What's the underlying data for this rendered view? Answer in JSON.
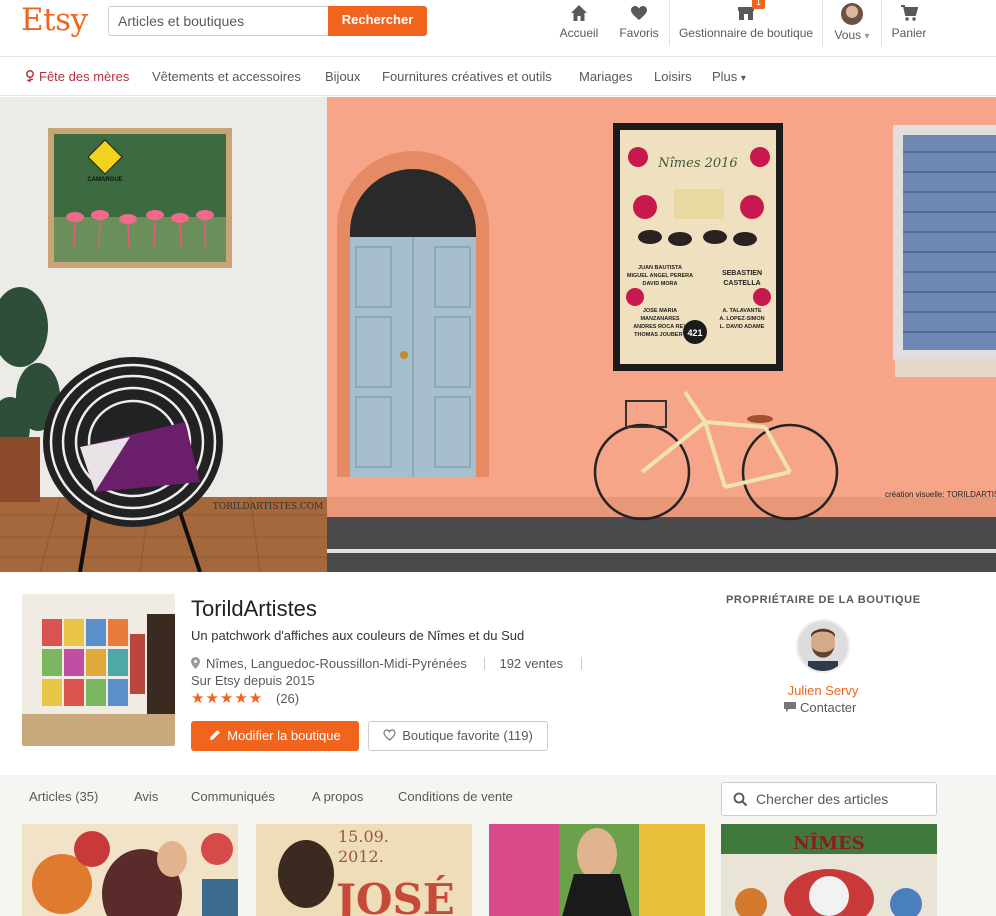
{
  "header": {
    "logo": "Etsy",
    "search_placeholder": "Articles et boutiques",
    "search_button": "Rechercher",
    "nav": {
      "home": "Accueil",
      "favorites": "Favoris",
      "shop_manager": "Gestionnaire de boutique",
      "shop_manager_badge": "1",
      "you": "Vous",
      "you_caret": "▾",
      "cart": "Panier"
    }
  },
  "categories": {
    "mothers_day": "Fête des mères",
    "clothing": "Vêtements et accessoires",
    "jewelry": "Bijoux",
    "craft_supplies": "Fournitures créatives et outils",
    "weddings": "Mariages",
    "leisure": "Loisirs",
    "more": "Plus",
    "more_caret": "▾"
  },
  "banner": {
    "watermark_left": "TORILDARTISTES.COM",
    "watermark_right": "création visuelle: TORILDARTISTES",
    "sign_text": "CAMARGUE",
    "poster_title": "Nîmes 2016",
    "poster_badge": "421",
    "poster_col1": [
      "JUAN BAUTISTA",
      "MIGUEL ANGEL PERERA",
      "DAVID MORA"
    ],
    "poster_col2": [
      "SEBASTIEN",
      "CASTELLA"
    ],
    "poster_col3": [
      "JOSE MARIA",
      "MANZANARES",
      "ANDRES ROCA REY",
      "THOMAS JOUBERT"
    ],
    "poster_col4": [
      "A. TALAVANTE",
      "A. LOPEZ-SIMON",
      "L. DAVID ADAME"
    ]
  },
  "shop": {
    "name": "TorildArtistes",
    "tagline": "Un patchwork d'affiches aux couleurs de Nîmes et du Sud",
    "location": "Nîmes, Languedoc-Roussillon-Midi-Pyrénées",
    "sales": "192 ventes",
    "since": "Sur Etsy depuis 2015",
    "rating_stars": "★★★★★",
    "rating": 5,
    "reviews": "(26)",
    "edit_button": "Modifier la boutique",
    "favorite_button": "Boutique favorite (119)"
  },
  "owner": {
    "section_title": "PROPRIÉTAIRE DE LA BOUTIQUE",
    "name": "Julien Servy",
    "contact": "Contacter"
  },
  "tabs": {
    "articles": "Articles (35)",
    "reviews": "Avis",
    "announcements": "Communiqués",
    "about": "A propos",
    "policies": "Conditions de vente"
  },
  "item_search_placeholder": "Chercher des articles",
  "thumbnails": {
    "t2_date": "15.09.",
    "t2_year": "2012.",
    "t2_name": "JOSÉ",
    "t4_title": "NÎMES"
  },
  "colors": {
    "accent": "#f1641e",
    "mothers_day": "#b52f3e",
    "wall_peach": "#f6a588"
  }
}
